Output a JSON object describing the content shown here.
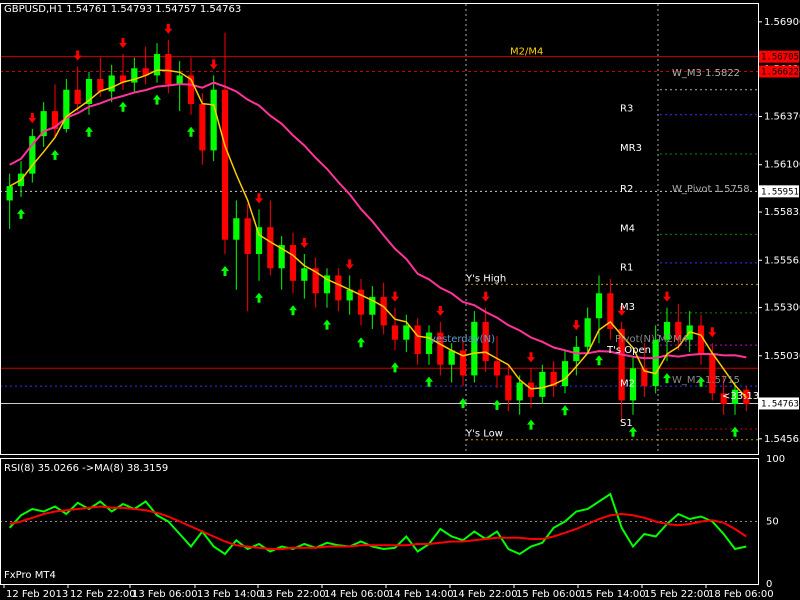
{
  "header": {
    "symbol_info": "GBPUSD,H1  1.54761 1.54793 1.54757 1.54763",
    "indicator_info": "RSI(8) 35.0266   ->MA(8) 38.3159",
    "broker_label": "FxPro MT4"
  },
  "colors": {
    "background": "#000000",
    "frame": "#ffffff",
    "bull_candle": "#00ff00",
    "bear_candle": "#ff0000",
    "fast_ma": "#ffcc00",
    "slow_ma": "#ff3399",
    "rsi_line": "#00ff00",
    "rsi_ma": "#ff0000",
    "arrow_up": "#00ff00",
    "arrow_down": "#ff0000"
  },
  "chart_data": [
    {
      "type": "candlestick",
      "title": "GBPUSD,H1",
      "ylim": [
        1.5448,
        1.57
      ],
      "y_ticks": [
        "1.56900",
        "1.56635",
        "1.56370",
        "1.56100",
        "1.55835",
        "1.55565",
        "1.55300",
        "1.55030",
        "1.54765",
        "1.54565"
      ],
      "x_ticks": [
        "12 Feb 2013",
        "12 Feb 22:00",
        "13 Feb 06:00",
        "13 Feb 14:00",
        "13 Feb 22:00",
        "14 Feb 06:00",
        "14 Feb 14:00",
        "14 Feb 22:00",
        "15 Feb 06:00",
        "15 Feb 14:00",
        "15 Feb 22:00",
        "18 Feb 06:00"
      ],
      "price_tags": [
        {
          "text": "1.56705",
          "color": "#ff0000",
          "price": 1.56705
        },
        {
          "text": "1.56622",
          "color": "#ff0000",
          "price": 1.56622
        },
        {
          "text": "1.55951",
          "color": "#ffffff",
          "price": 1.55951
        },
        {
          "text": "1.54763",
          "color": "#ffffff",
          "price": 1.54763
        }
      ],
      "level_labels": [
        {
          "text": "M2/M4",
          "color": "#ffcc00",
          "price": 1.567
        },
        {
          "text": "W_M3 1.5822",
          "color": "#b0b0b0",
          "price": 1.5658
        },
        {
          "text": "R3",
          "color": "#ffffff",
          "price": 1.5638
        },
        {
          "text": "MR3",
          "color": "#ffffff",
          "price": 1.5616
        },
        {
          "text": "R2",
          "color": "#ffffff",
          "price": 1.5593
        },
        {
          "text": "W_Pivot 1.5758",
          "color": "#b0b0b0",
          "price": 1.5593
        },
        {
          "text": "M4",
          "color": "#ffffff",
          "price": 1.5571
        },
        {
          "text": "R1",
          "color": "#ffffff",
          "price": 1.5549
        },
        {
          "text": "Y's High",
          "color": "#ffffff",
          "price": 1.5543
        },
        {
          "text": "M3",
          "color": "#ffffff",
          "price": 1.5527
        },
        {
          "text": "yesterday(N)",
          "color": "#6699cc",
          "price": 1.5509
        },
        {
          "text": "Pivot(N) M2M4",
          "color": "#888888",
          "price": 1.5509
        },
        {
          "text": "T's Open",
          "color": "#ffffff",
          "price": 1.5503
        },
        {
          "text": "W_M2 1.5715",
          "color": "#888888",
          "price": 1.5486
        },
        {
          "text": "M2",
          "color": "#ffffff",
          "price": 1.5484
        },
        {
          "text": "<33:13",
          "color": "#ffffff",
          "price": 1.5477
        },
        {
          "text": "S1",
          "color": "#ffffff",
          "price": 1.5462
        },
        {
          "text": "Y's Low",
          "color": "#ffffff",
          "price": 1.5456
        }
      ],
      "candles": [
        [
          1.559,
          1.5605,
          1.5574,
          1.5598
        ],
        [
          1.5598,
          1.5612,
          1.5592,
          1.5605
        ],
        [
          1.5605,
          1.563,
          1.56,
          1.5626
        ],
        [
          1.5626,
          1.5645,
          1.562,
          1.564
        ],
        [
          1.564,
          1.5655,
          1.5625,
          1.563
        ],
        [
          1.563,
          1.5658,
          1.5628,
          1.5652
        ],
        [
          1.5652,
          1.5665,
          1.564,
          1.5644
        ],
        [
          1.5644,
          1.5662,
          1.5638,
          1.5658
        ],
        [
          1.5658,
          1.567,
          1.5648,
          1.5651
        ],
        [
          1.5651,
          1.5666,
          1.5645,
          1.566
        ],
        [
          1.566,
          1.5672,
          1.5652,
          1.5656
        ],
        [
          1.5656,
          1.567,
          1.565,
          1.5664
        ],
        [
          1.5664,
          1.5676,
          1.5655,
          1.566
        ],
        [
          1.566,
          1.5678,
          1.5656,
          1.5672
        ],
        [
          1.5672,
          1.568,
          1.565,
          1.5655
        ],
        [
          1.5655,
          1.5668,
          1.564,
          1.566
        ],
        [
          1.566,
          1.567,
          1.5638,
          1.5644
        ],
        [
          1.5644,
          1.565,
          1.561,
          1.5618
        ],
        [
          1.5618,
          1.566,
          1.5612,
          1.5652
        ],
        [
          1.5652,
          1.5684,
          1.556,
          1.5568
        ],
        [
          1.5568,
          1.559,
          1.554,
          1.558
        ],
        [
          1.558,
          1.5588,
          1.5528,
          1.556
        ],
        [
          1.556,
          1.5585,
          1.5545,
          1.5575
        ],
        [
          1.5575,
          1.559,
          1.5548,
          1.5552
        ],
        [
          1.5552,
          1.557,
          1.554,
          1.5565
        ],
        [
          1.5565,
          1.5572,
          1.5538,
          1.5545
        ],
        [
          1.5545,
          1.556,
          1.5535,
          1.5552
        ],
        [
          1.5552,
          1.5558,
          1.553,
          1.5538
        ],
        [
          1.5538,
          1.5552,
          1.553,
          1.5548
        ],
        [
          1.5548,
          1.5552,
          1.5528,
          1.5534
        ],
        [
          1.5534,
          1.5548,
          1.5526,
          1.554
        ],
        [
          1.554,
          1.5546,
          1.552,
          1.5526
        ],
        [
          1.5526,
          1.5542,
          1.5518,
          1.5536
        ],
        [
          1.5536,
          1.5544,
          1.5515,
          1.552
        ],
        [
          1.552,
          1.553,
          1.5506,
          1.5512
        ],
        [
          1.5512,
          1.5526,
          1.5505,
          1.552
        ],
        [
          1.552,
          1.5524,
          1.5498,
          1.5504
        ],
        [
          1.5504,
          1.552,
          1.5498,
          1.5516
        ],
        [
          1.5516,
          1.5522,
          1.5492,
          1.5498
        ],
        [
          1.5498,
          1.551,
          1.5488,
          1.5506
        ],
        [
          1.5506,
          1.5512,
          1.5486,
          1.5492
        ],
        [
          1.5492,
          1.5528,
          1.5488,
          1.5522
        ],
        [
          1.5522,
          1.553,
          1.5494,
          1.55
        ],
        [
          1.55,
          1.5514,
          1.5485,
          1.5492
        ],
        [
          1.5492,
          1.5498,
          1.5472,
          1.5478
        ],
        [
          1.5478,
          1.5492,
          1.547,
          1.5488
        ],
        [
          1.5488,
          1.5496,
          1.5474,
          1.548
        ],
        [
          1.548,
          1.5498,
          1.5476,
          1.5494
        ],
        [
          1.5494,
          1.55,
          1.548,
          1.5486
        ],
        [
          1.5486,
          1.5506,
          1.5482,
          1.55
        ],
        [
          1.55,
          1.5514,
          1.5492,
          1.5508
        ],
        [
          1.5508,
          1.553,
          1.5504,
          1.5524
        ],
        [
          1.5524,
          1.5548,
          1.551,
          1.5538
        ],
        [
          1.5538,
          1.5546,
          1.5512,
          1.5518
        ],
        [
          1.5518,
          1.5522,
          1.5466,
          1.5478
        ],
        [
          1.5478,
          1.5502,
          1.547,
          1.5496
        ],
        [
          1.5496,
          1.551,
          1.548,
          1.5486
        ],
        [
          1.5486,
          1.552,
          1.5482,
          1.5512
        ],
        [
          1.5512,
          1.553,
          1.55,
          1.5522
        ],
        [
          1.5522,
          1.5532,
          1.5506,
          1.5512
        ],
        [
          1.5512,
          1.5528,
          1.5505,
          1.552
        ],
        [
          1.552,
          1.5526,
          1.5498,
          1.5504
        ],
        [
          1.5504,
          1.551,
          1.5478,
          1.5482
        ],
        [
          1.5482,
          1.5492,
          1.547,
          1.5476
        ],
        [
          1.5476,
          1.5488,
          1.547,
          1.5484
        ],
        [
          1.5484,
          1.5486,
          1.5472,
          1.5476
        ]
      ]
    },
    {
      "type": "line",
      "title": "RSI(8) 35.0266   ->MA(8) 38.3159",
      "ylim": [
        0,
        100
      ],
      "y_ticks": [
        "100",
        "50",
        "0"
      ],
      "series": [
        {
          "name": "RSI(8)",
          "color": "#00ff00",
          "values": [
            45,
            55,
            60,
            58,
            62,
            56,
            65,
            60,
            66,
            58,
            64,
            60,
            66,
            55,
            50,
            40,
            30,
            42,
            30,
            24,
            35,
            28,
            32,
            26,
            30,
            28,
            32,
            29,
            33,
            31,
            30,
            34,
            30,
            28,
            29,
            38,
            26,
            32,
            44,
            38,
            35,
            42,
            36,
            42,
            28,
            24,
            30,
            33,
            45,
            50,
            58,
            60,
            66,
            72,
            45,
            30,
            40,
            38,
            48,
            56,
            52,
            54,
            50,
            40,
            28,
            30
          ]
        },
        {
          "name": "MA(8)",
          "color": "#ff0000",
          "values": [
            48,
            50,
            53,
            56,
            58,
            59,
            60,
            61,
            62,
            61,
            61,
            60,
            59,
            57,
            54,
            50,
            46,
            42,
            38,
            34,
            31,
            30,
            29,
            28,
            28,
            29,
            29,
            29,
            30,
            30,
            30,
            31,
            31,
            31,
            31,
            31,
            32,
            32,
            33,
            34,
            34,
            35,
            36,
            37,
            37,
            37,
            36,
            36,
            38,
            41,
            44,
            48,
            52,
            55,
            56,
            55,
            53,
            50,
            48,
            47,
            48,
            50,
            51,
            49,
            44,
            38
          ]
        }
      ]
    }
  ]
}
